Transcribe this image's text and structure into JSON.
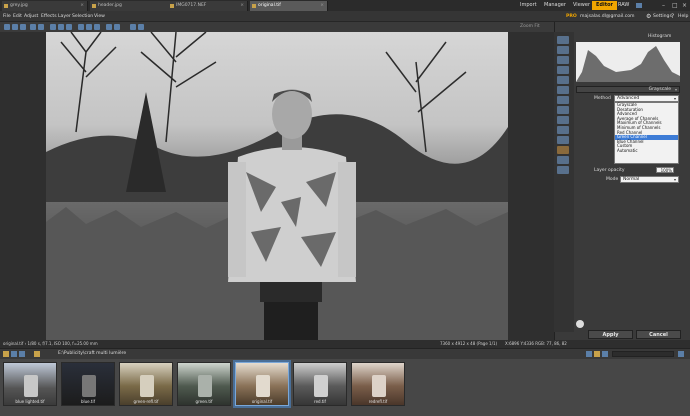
{
  "tabs": [
    {
      "label": "grey.jpg"
    },
    {
      "label": "header.jpg"
    },
    {
      "label": "IMG0717.NEF"
    },
    {
      "label": "original.tif",
      "active": true
    }
  ],
  "top_nav": [
    "Import",
    "Manager",
    "Viewer",
    "Editor",
    "RAW"
  ],
  "menu": [
    "File",
    "Edit",
    "Adjust",
    "Effects",
    "Layer",
    "Selection",
    "View"
  ],
  "account": {
    "badge": "PRO",
    "email": "majsalas.dl@gmail.com",
    "settings": "Settings",
    "help": "Help"
  },
  "panel": {
    "histogram_label": "Histogram",
    "mode_selector": "Grayscale",
    "method_label": "Method",
    "method_value": "Advanced",
    "dropdown_options": [
      "Grayscale",
      "Desaturation",
      "Advanced",
      "Average of Channels",
      "Maximum of Channels",
      "Minimum of Channels",
      "Red Channel",
      "Green Channel",
      "Blue Channel",
      "Custom",
      "Automatic"
    ],
    "selected_option": "Green Channel",
    "layer_opacity_label": "Layer opacity",
    "layer_opacity_value": "100%",
    "mode_label": "Mode",
    "mode_value": "Normal",
    "apply": "Apply",
    "cancel": "Cancel",
    "zoom": "Zoom Fit"
  },
  "status": {
    "left": "original.tif ‹ 1/80 s, f/7.1, ISO 100, f=25.00 mm",
    "right": "7360 x 4912 x 48 (Page 1/1)",
    "coords": "X:6896 Y:4336 RGB: 77, 86, 82"
  },
  "path": "E:\\Publicity\\craft multi lumière",
  "thumbnails": [
    {
      "label": "blue lighted.tif"
    },
    {
      "label": "blue.tif"
    },
    {
      "label": "green-refl.tif"
    },
    {
      "label": "green.tif"
    },
    {
      "label": "original.tif",
      "selected": true
    },
    {
      "label": "red.tif"
    },
    {
      "label": "redrefl.tif"
    }
  ]
}
